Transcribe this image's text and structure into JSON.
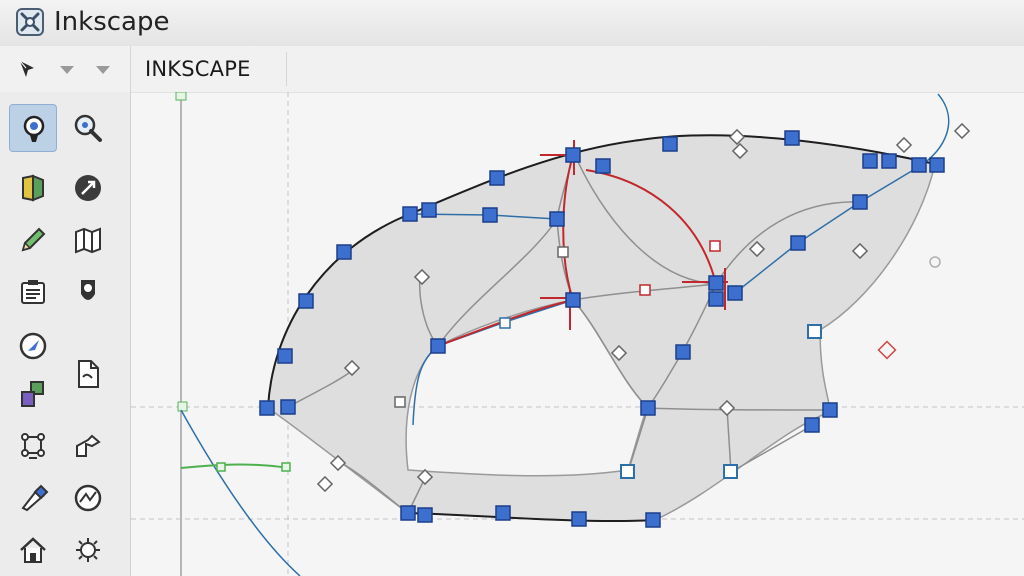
{
  "window": {
    "title": "Inkscape"
  },
  "tool_controls": {
    "label": "INKSCAPE"
  },
  "toolbox": {
    "tools": [
      {
        "name": "selector-tool",
        "icon": "pointer-icon",
        "active": true
      },
      {
        "name": "node-tool",
        "icon": "node-icon",
        "active": false
      },
      {
        "name": "shape-builder-tool",
        "icon": "shape-builder-icon",
        "active": false
      },
      {
        "name": "tweak-tool",
        "icon": "tweak-icon",
        "active": false
      },
      {
        "name": "pencil-tool",
        "icon": "pencil-icon",
        "active": false
      },
      {
        "name": "calligraphy-tool",
        "icon": "calligraphy-icon",
        "active": false
      },
      {
        "name": "text-tool",
        "icon": "text-icon",
        "active": false
      },
      {
        "name": "spray-tool",
        "icon": "spray-icon",
        "active": false
      },
      {
        "name": "measure-tool",
        "icon": "measure-icon",
        "active": false
      },
      {
        "name": "page-tool",
        "icon": "page-icon",
        "active": false
      },
      {
        "name": "connector-tool",
        "icon": "connector-icon",
        "active": false
      },
      {
        "name": "pen-tool",
        "icon": "pen-icon",
        "active": false
      },
      {
        "name": "mesh-tool",
        "icon": "mesh-icon",
        "active": false
      },
      {
        "name": "dropper-tool",
        "icon": "dropper-icon",
        "active": false
      },
      {
        "name": "eraser-tool",
        "icon": "eraser-icon",
        "active": false
      },
      {
        "name": "zoom-tool",
        "icon": "zoom-icon",
        "active": false
      },
      {
        "name": "home-tool",
        "icon": "home-icon",
        "active": false
      },
      {
        "name": "lpe-tool",
        "icon": "lpe-icon",
        "active": false
      }
    ]
  },
  "colors": {
    "node_fill": "#3d6fcf",
    "node_stroke": "#1c3f8c",
    "active_path": "#c0282d",
    "guide": "#b8b8b8",
    "shape_fill": "#dcdcdc"
  }
}
